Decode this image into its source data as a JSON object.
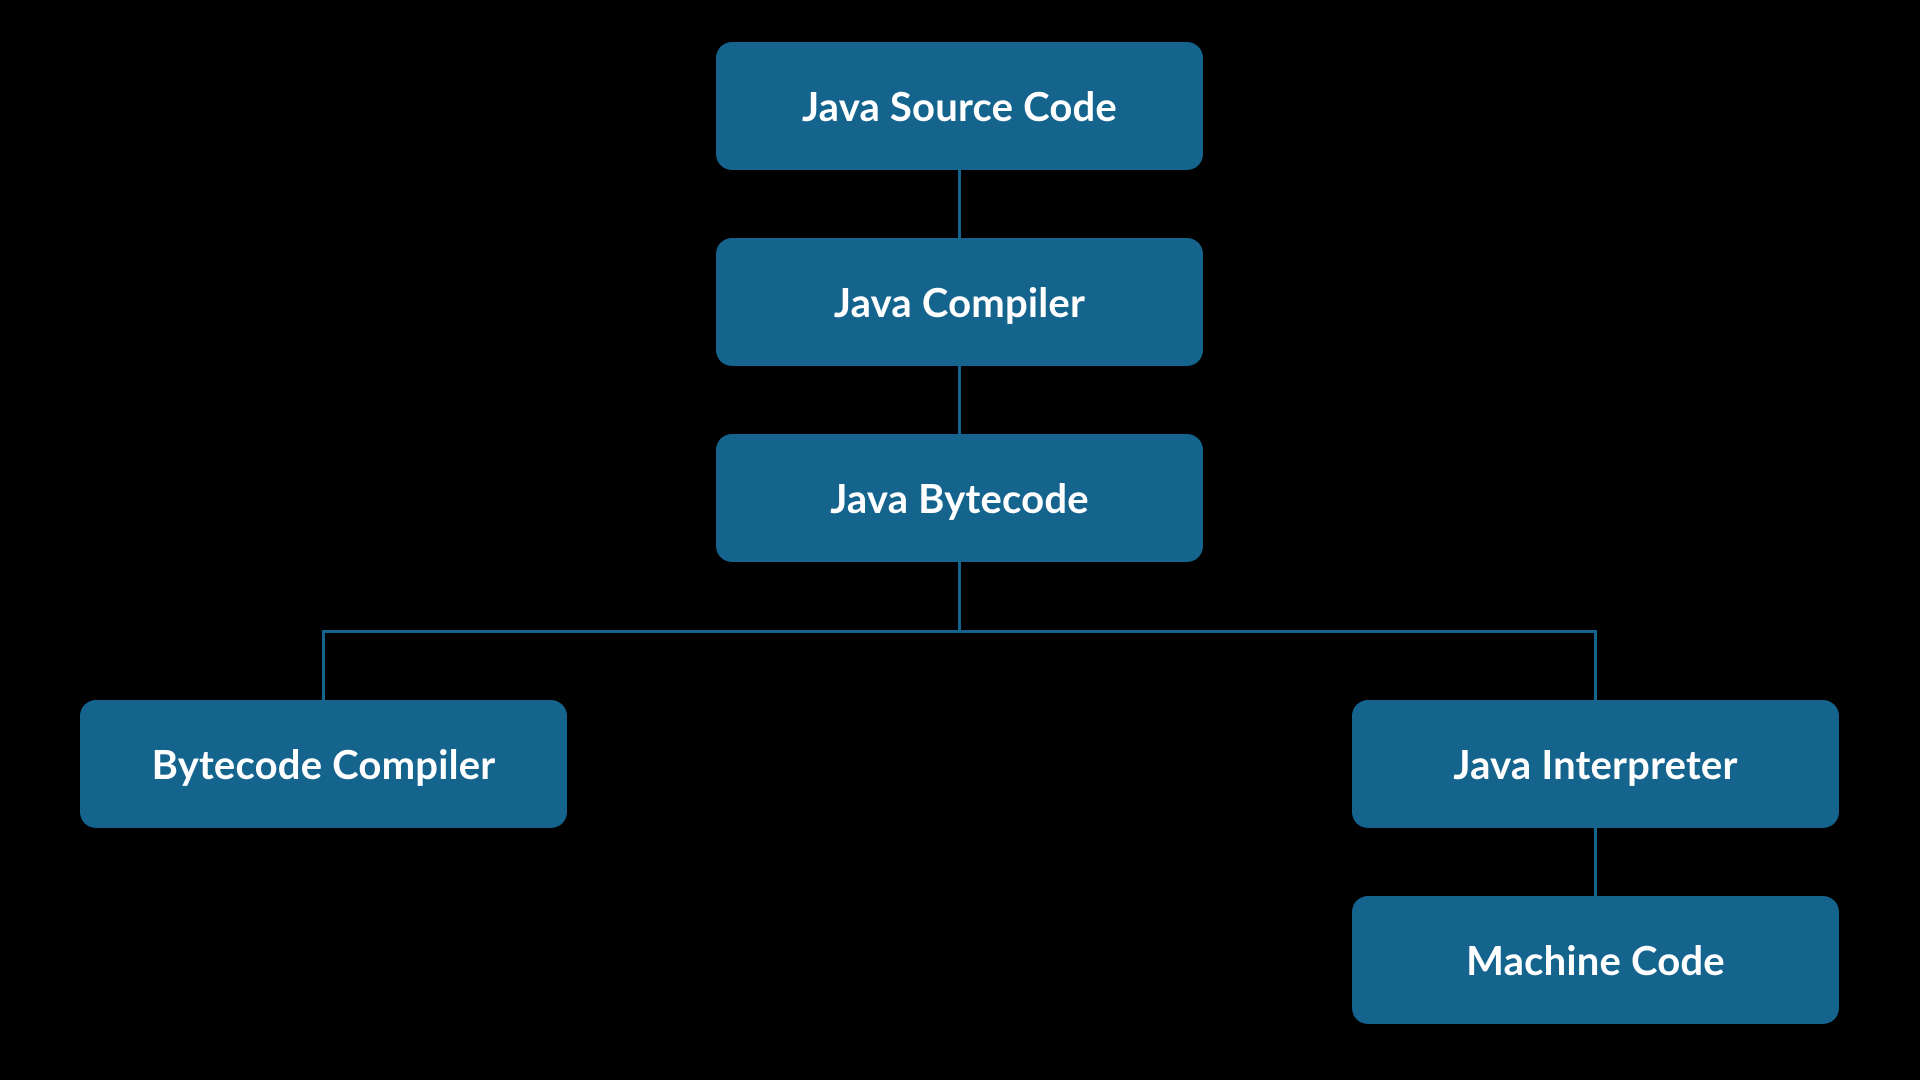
{
  "colors": {
    "background": "#000000",
    "node_fill": "#14648e",
    "node_text": "#ffffff",
    "connector": "#14648e"
  },
  "nodes": {
    "source": {
      "label": "Java Source Code"
    },
    "compiler": {
      "label": "Java Compiler"
    },
    "bytecode": {
      "label": "Java Bytecode"
    },
    "bcompiler": {
      "label": "Bytecode Compiler"
    },
    "interpreter": {
      "label": "Java Interpreter"
    },
    "machine": {
      "label": "Machine Code"
    }
  }
}
